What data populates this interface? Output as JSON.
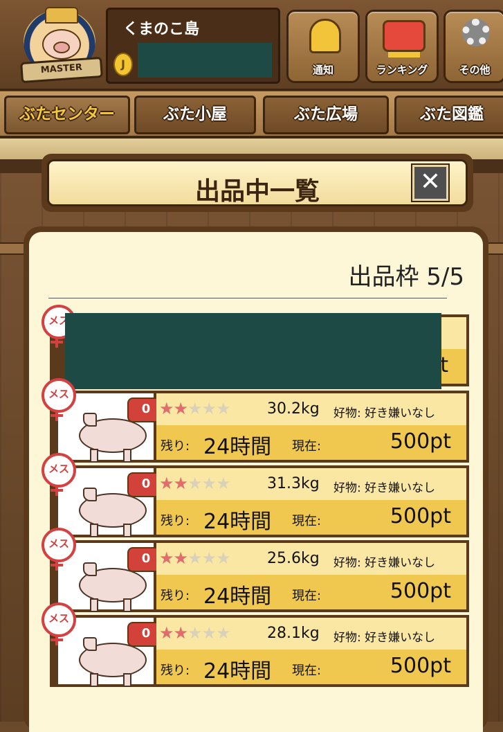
{
  "header": {
    "avatar_banner": "MASTER",
    "island_name": "くまのこ島",
    "coin_symbol": "J",
    "buttons": [
      {
        "label": "通知",
        "icon": "bell-icon"
      },
      {
        "label": "ランキング",
        "icon": "crown-icon"
      },
      {
        "label": "その他",
        "icon": "gear-icon"
      }
    ]
  },
  "tabs": [
    {
      "label": "ぶたセンター",
      "active": true
    },
    {
      "label": "ぶた小屋",
      "active": false
    },
    {
      "label": "ぶた広場",
      "active": false
    },
    {
      "label": "ぶた図鑑",
      "active": false
    }
  ],
  "dialog": {
    "title": "出品中一覧",
    "close_symbol": "✕",
    "slots_label": "出品枠 5/5"
  },
  "listings": [
    {
      "gender": "メス",
      "bids": "0",
      "stars": 2,
      "max_stars": 5,
      "weight": "30.2kg",
      "likes": "好物: 好き嫌いなし",
      "remain_label": "残り:",
      "remain_value": "24時間",
      "current_label": "現在:",
      "price": "500pt"
    },
    {
      "gender": "メス",
      "bids": "0",
      "stars": 2,
      "max_stars": 5,
      "weight": "31.3kg",
      "likes": "好物: 好き嫌いなし",
      "remain_label": "残り:",
      "remain_value": "24時間",
      "current_label": "現在:",
      "price": "500pt"
    },
    {
      "gender": "メス",
      "bids": "0",
      "stars": 2,
      "max_stars": 5,
      "weight": "25.6kg",
      "likes": "好物: 好き嫌いなし",
      "remain_label": "残り:",
      "remain_value": "24時間",
      "current_label": "現在:",
      "price": "500pt"
    },
    {
      "gender": "メス",
      "bids": "0",
      "stars": 2,
      "max_stars": 5,
      "weight": "28.1kg",
      "likes": "好物: 好き嫌いなし",
      "remain_label": "残り:",
      "remain_value": "24時間",
      "current_label": "現在:",
      "price": "500pt"
    }
  ],
  "first_item_partial": {
    "gender": "メス",
    "visible_text": "t"
  },
  "colors": {
    "accent_red": "#d2423a",
    "row_light": "#fbe7a4",
    "row_dark": "#f0c84f",
    "wood_dark": "#5b3a1c"
  }
}
